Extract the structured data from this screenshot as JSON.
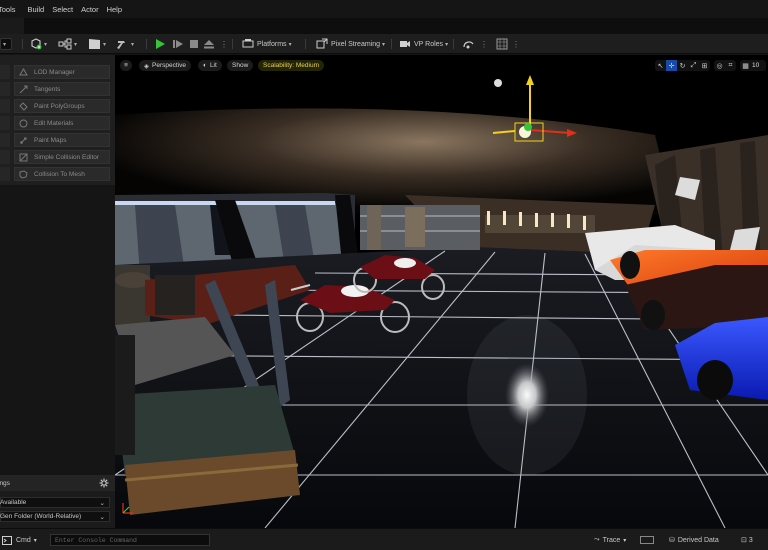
{
  "menu": [
    "Tools",
    "Build",
    "Select",
    "Actor",
    "Help"
  ],
  "toolbar": {
    "platforms": "Platforms",
    "pixel_streaming": "Pixel Streaming",
    "vp_roles": "VP Roles"
  },
  "modes": [
    "LOD Manager",
    "Tangents",
    "Paint PolyGroups",
    "Edit Materials",
    "Paint Maps",
    "Simple Collision Editor",
    "Collision To Mesh"
  ],
  "settings": {
    "title": "ings",
    "row1": "Available",
    "row2": "Gen Folder (World-Relative)"
  },
  "viewport": {
    "perspective": "Perspective",
    "lit": "Lit",
    "show": "Show",
    "scalability": "Scalability: Medium",
    "grid_size": "10"
  },
  "status": {
    "cmd": "Cmd",
    "console_placeholder": "Enter Console Command",
    "trace": "Trace",
    "derived_data": "Derived Data",
    "count": "3"
  },
  "colors": {
    "accent_play": "#35c43a",
    "scalability": "#e6d34b",
    "gizmo_y": "#f2d21b",
    "gizmo_x": "#e0301c",
    "car_orange": "#ff5a14",
    "car_blue": "#1530e0"
  }
}
